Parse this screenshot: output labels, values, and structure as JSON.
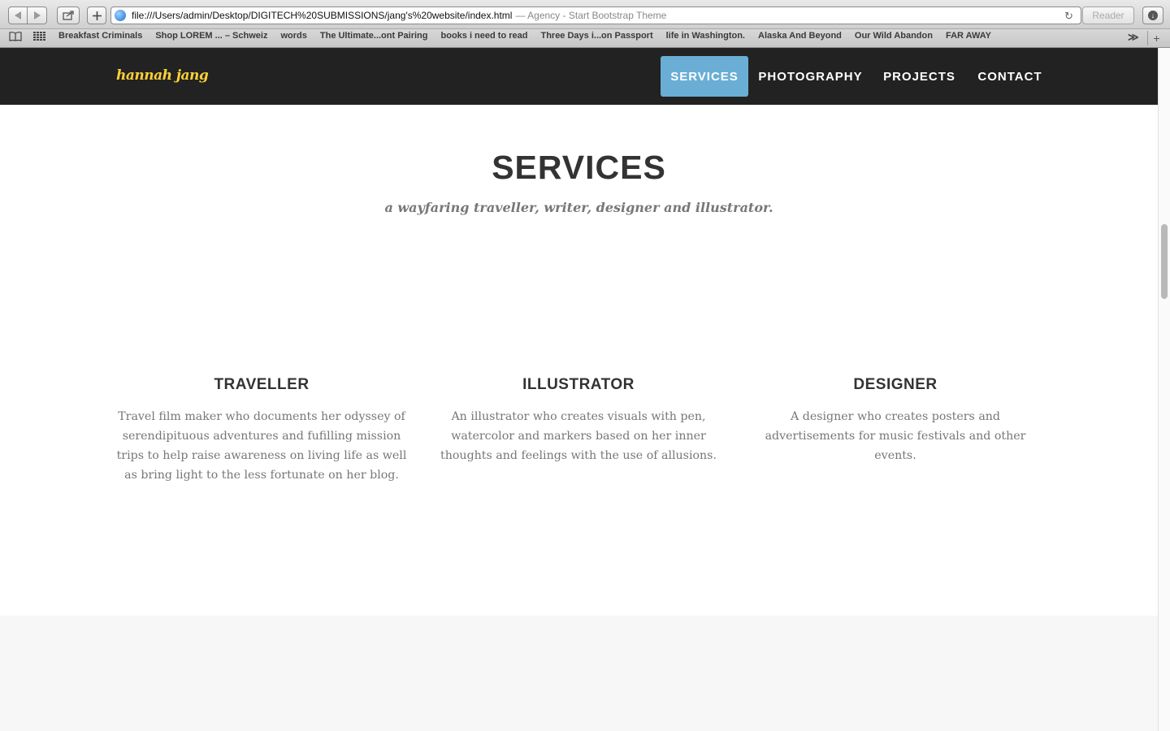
{
  "browser": {
    "url": "file:///Users/admin/Desktop/DIGITECH%20SUBMISSIONS/jang's%20website/index.html",
    "page_title": "— Agency - Start Bootstrap Theme",
    "reader_label": "Reader",
    "bookmarks": [
      "Breakfast Criminals",
      "Shop LOREM ... – Schweiz",
      "words",
      "The Ultimate...ont Pairing",
      "books i need to read",
      "Three Days i...on Passport",
      "life in Washington.",
      "Alaska And Beyond",
      "Our Wild Abandon",
      "FAR AWAY"
    ],
    "more_glyph": "≫",
    "add_glyph": "+"
  },
  "navbar": {
    "brand": "hannah jang",
    "items": [
      "SERVICES",
      "PHOTOGRAPHY",
      "PROJECTS",
      "CONTACT"
    ],
    "active": "SERVICES",
    "active_color": "#6aaed6",
    "brand_color": "#fed136"
  },
  "services": {
    "heading": "SERVICES",
    "subheading": "a wayfaring traveller, writer, designer and illustrator.",
    "items": [
      {
        "title": "TRAVELLER",
        "text": "Travel film maker who documents her odyssey of serendipituous adventures and fufilling mission trips to help raise awareness on living life as well as bring light to the less fortunate on her blog."
      },
      {
        "title": "ILLUSTRATOR",
        "text": "An illustrator who creates visuals with pen, watercolor and markers based on her inner thoughts and feelings with the use of allusions."
      },
      {
        "title": "DESIGNER",
        "text": "A designer who creates posters and advertisements for music festivals and other events."
      }
    ]
  }
}
